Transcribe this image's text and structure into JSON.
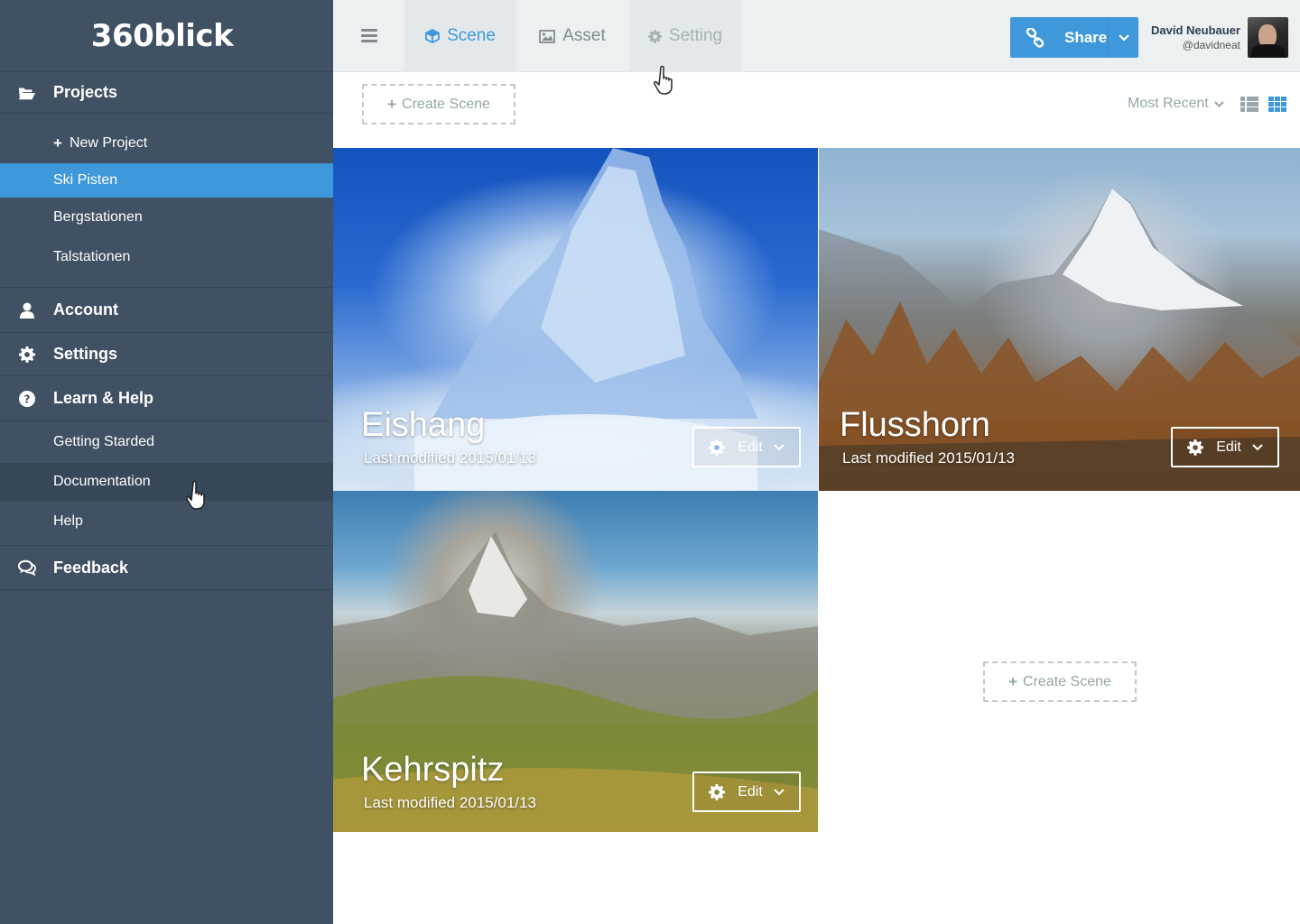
{
  "app": {
    "logo": "360blick"
  },
  "sidebar": {
    "projects": {
      "label": "Projects",
      "icon": "folder-open-icon"
    },
    "project_items": [
      {
        "label": "New Project",
        "prefix": "+"
      },
      {
        "label": "Ski Pisten",
        "active": true
      },
      {
        "label": "Bergstationen"
      },
      {
        "label": "Talstationen"
      }
    ],
    "account": {
      "label": "Account",
      "icon": "user-icon"
    },
    "settings": {
      "label": "Settings",
      "icon": "gear-icon"
    },
    "learn": {
      "label": "Learn & Help",
      "icon": "question-circle-icon"
    },
    "learn_items": [
      {
        "label": "Getting Starded"
      },
      {
        "label": "Documentation",
        "hovered": true
      },
      {
        "label": "Help"
      }
    ],
    "feedback": {
      "label": "Feedback",
      "icon": "comments-icon"
    }
  },
  "topbar": {
    "tabs": [
      {
        "label": "Scene",
        "icon": "cube-icon",
        "active": true
      },
      {
        "label": "Asset",
        "icon": "image-icon"
      },
      {
        "label": "Setting",
        "icon": "gear-icon",
        "hovered": true
      }
    ],
    "share": {
      "label": "Share",
      "icon": "link-icon"
    },
    "user": {
      "name": "David Neubauer",
      "handle": "@davidneat"
    }
  },
  "toolbar": {
    "create_label": "Create Scene",
    "create_prefix": "+",
    "sort_label": "Most Recent",
    "views": [
      "list-view-icon",
      "grid-view-icon"
    ],
    "active_view": "grid"
  },
  "scenes": [
    {
      "title": "Eishang",
      "modified": "Last modified 2015/01/13",
      "edit_label": "Edit"
    },
    {
      "title": "Flusshorn",
      "modified": "Last modified 2015/01/13",
      "edit_label": "Edit"
    },
    {
      "title": "Kehrspitz",
      "modified": "Last modified 2015/01/13",
      "edit_label": "Edit"
    }
  ],
  "empty_slot": {
    "create_label": "Create Scene",
    "create_prefix": "+"
  },
  "colors": {
    "sidebar_bg": "#3f5163",
    "accent": "#3e98da",
    "topbar_bg": "#ecf0f1",
    "muted_text": "#95a5a6"
  }
}
